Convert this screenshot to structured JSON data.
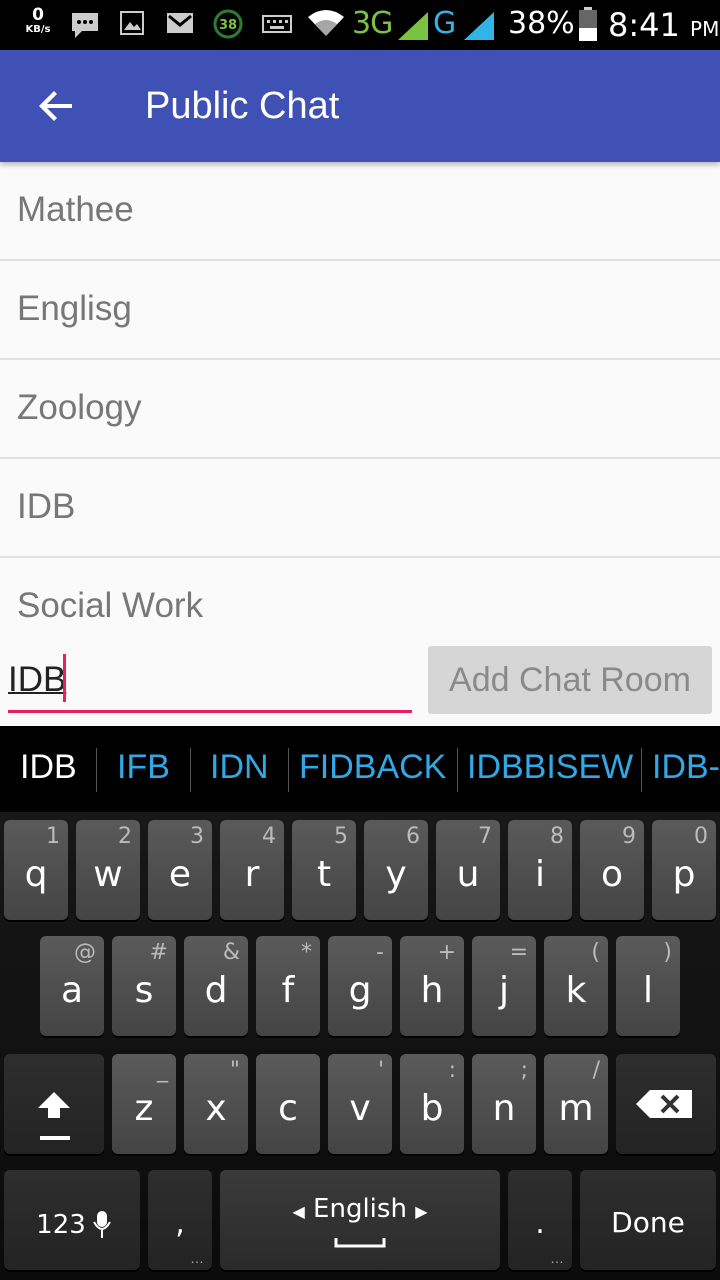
{
  "status_bar": {
    "net_speed": "0",
    "net_unit": "KB/s",
    "notification_count": "38",
    "network_3g": "3G",
    "network_g": "G",
    "battery": "38%",
    "time": "8:41",
    "ampm": "PM"
  },
  "app_bar": {
    "title": "Public Chat"
  },
  "rooms": [
    "Mathee",
    "Englisg",
    "Zoology",
    "IDB",
    "Social Work"
  ],
  "composer": {
    "value": "IDB",
    "button_label": "Add Chat Room"
  },
  "keyboard": {
    "suggestions": [
      "IDB",
      "IFB",
      "IDN",
      "FIDBACK",
      "IDBBISEW",
      "IDB-"
    ],
    "row1": [
      {
        "k": "q",
        "h": "1"
      },
      {
        "k": "w",
        "h": "2"
      },
      {
        "k": "e",
        "h": "3"
      },
      {
        "k": "r",
        "h": "4"
      },
      {
        "k": "t",
        "h": "5"
      },
      {
        "k": "y",
        "h": "6"
      },
      {
        "k": "u",
        "h": "7"
      },
      {
        "k": "i",
        "h": "8"
      },
      {
        "k": "o",
        "h": "9"
      },
      {
        "k": "p",
        "h": "0"
      }
    ],
    "row2": [
      {
        "k": "a",
        "h": "@"
      },
      {
        "k": "s",
        "h": "#"
      },
      {
        "k": "d",
        "h": "&"
      },
      {
        "k": "f",
        "h": "*"
      },
      {
        "k": "g",
        "h": "-"
      },
      {
        "k": "h",
        "h": "+"
      },
      {
        "k": "j",
        "h": "="
      },
      {
        "k": "k",
        "h": "("
      },
      {
        "k": "l",
        "h": ")"
      }
    ],
    "row3": [
      {
        "k": "z",
        "h": "_"
      },
      {
        "k": "x",
        "h": "\""
      },
      {
        "k": "c",
        "h": ""
      },
      {
        "k": "v",
        "h": "'"
      },
      {
        "k": "b",
        "h": ":"
      },
      {
        "k": "n",
        "h": ";"
      },
      {
        "k": "m",
        "h": "/"
      }
    ],
    "symbols_label": "123",
    "comma": ",",
    "language": "English",
    "period": ".",
    "done_label": "Done"
  }
}
